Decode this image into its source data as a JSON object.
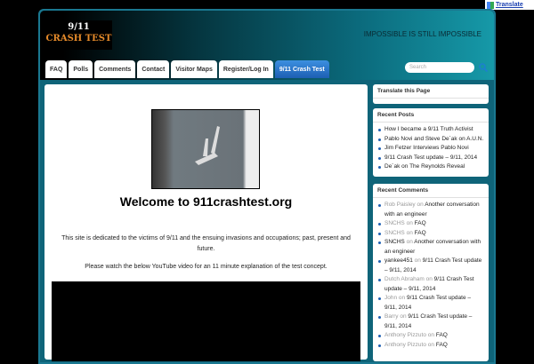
{
  "translate_widget": {
    "label": "Translate"
  },
  "header": {
    "logo_line1": "9/11",
    "logo_line2": "CRASH TEST",
    "tagline": "IMPOSSIBLE IS STILL IMPOSSIBLE"
  },
  "nav": {
    "tabs": [
      "FAQ",
      "Polls",
      "Comments",
      "Contact",
      "Visitor Maps",
      "Register/Log In",
      "9/11 Crash Test"
    ],
    "active": "9/11 Crash Test"
  },
  "search": {
    "placeholder": "Search"
  },
  "main": {
    "title": "Welcome to 911crashtest.org",
    "intro": "This site is dedicated to the victims of 9/11 and the ensuing invasions and occupations; past, present and future.",
    "video_note": "Please watch the below YouTube video for an 11 minute explanation of the test concept."
  },
  "sidebar": {
    "translate_title": "Translate this Page",
    "recent_posts_title": "Recent Posts",
    "recent_posts": [
      "How I became a 9/11 Truth Activist",
      "Pablo Novi and Steve De´ak on A.U.N.",
      "Jim Fetzer Interviews Pablo Novi",
      "9/11 Crash Test update – 9/11, 2014",
      "De´ak on The Reynolds Reveal"
    ],
    "recent_comments_title": "Recent Comments",
    "on": "on",
    "recent_comments": [
      {
        "author": "Rob Paisley",
        "post": "Another conversation with an engineer",
        "linked": true
      },
      {
        "author": "SNCHS",
        "post": "FAQ",
        "linked": true
      },
      {
        "author": "SNCHS",
        "post": "FAQ",
        "linked": true
      },
      {
        "author": "SNCHS",
        "post": "Another conversation with an engineer",
        "linked": false
      },
      {
        "author": "yankee451",
        "post": "9/11 Crash Test update – 9/11, 2014",
        "linked": false
      },
      {
        "author": "Dutch Abraham",
        "post": "9/11 Crash Test update – 9/11, 2014",
        "linked": true
      },
      {
        "author": "John",
        "post": "9/11 Crash Test update – 9/11, 2014",
        "linked": true
      },
      {
        "author": "Barry",
        "post": "9/11 Crash Test update – 9/11, 2014",
        "linked": true
      },
      {
        "author": "Anthony Pizzuto",
        "post": "FAQ",
        "linked": true
      },
      {
        "author": "Anthony Pizzuto",
        "post": "FAQ",
        "linked": true
      }
    ]
  }
}
